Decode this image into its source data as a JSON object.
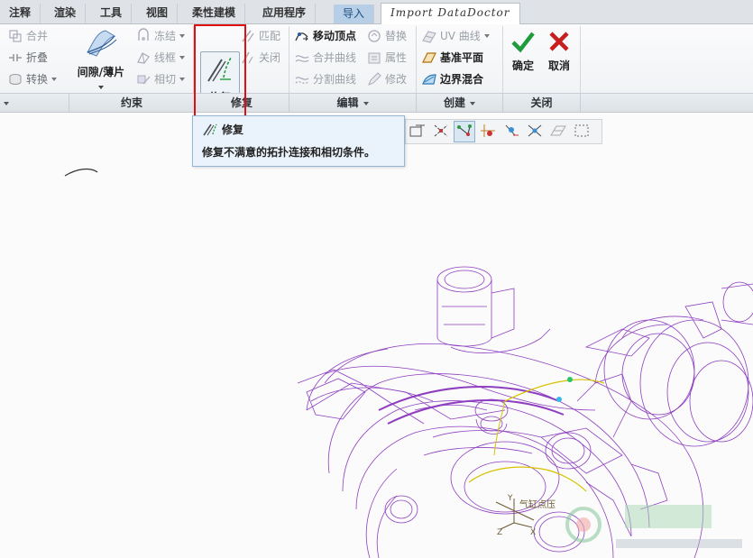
{
  "tabs": [
    {
      "label": "注释"
    },
    {
      "label": "渲染"
    },
    {
      "label": "工具"
    },
    {
      "label": "视图"
    },
    {
      "label": "柔性建模"
    },
    {
      "label": "应用程序"
    },
    {
      "label": "导入"
    },
    {
      "label": "Import DataDoctor"
    }
  ],
  "ribbon": {
    "constraint": {
      "merge": "合并",
      "fold": "折叠",
      "convert": "转换",
      "gap_thin": "间隙/薄片",
      "freeze": "冻结",
      "wireframe": "线框",
      "tangent": "相切"
    },
    "repair": {
      "repair": "修复",
      "match": "匹配",
      "close": "关闭"
    },
    "edit": {
      "move_vertex": "移动顶点",
      "merge_curve": "合并曲线",
      "split_curve": "分割曲线",
      "replace": "替换",
      "properties": "属性",
      "modify": "修改"
    },
    "create": {
      "uv_curve": "UV 曲线",
      "datum_plane": "基准平面",
      "boundary_blend": "边界混合"
    },
    "close": {
      "ok": "确定",
      "cancel": "取消"
    }
  },
  "groups": {
    "constraint": "约束",
    "repair": "修复",
    "edit": "编辑",
    "create": "创建",
    "close": "关闭"
  },
  "tooltip": {
    "title": "修复",
    "description": "修复不满意的拓扑连接和相切条件。"
  },
  "model": {
    "label": "气缸点压",
    "axis_x": "X",
    "axis_y": "Y",
    "axis_z": "Z"
  },
  "colors": {
    "model_wire": "#8e3fc0",
    "yellow_edge": "#d8c200",
    "tooltip_bg": "#eaf3fb",
    "highlight_red": "#e01010"
  }
}
